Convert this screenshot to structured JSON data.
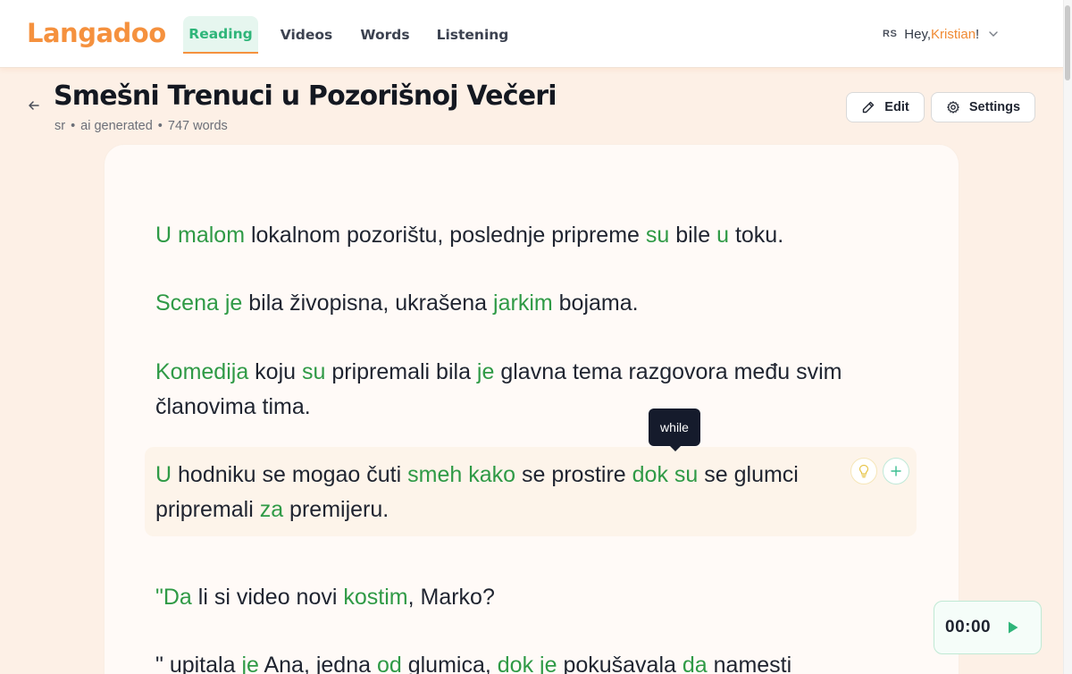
{
  "app": {
    "logo": "Langadoo"
  },
  "nav": [
    {
      "label": "Reading",
      "active": true
    },
    {
      "label": "Videos",
      "active": false
    },
    {
      "label": "Words",
      "active": false
    },
    {
      "label": "Listening",
      "active": false
    }
  ],
  "user": {
    "lang_code": "RS",
    "greeting": "Hey, ",
    "name": "Kristian",
    "suffix": "!"
  },
  "page": {
    "title": "Smešni Trenuci u Pozorišnoj Večeri",
    "meta_lang": "sr",
    "meta_source": "ai generated",
    "meta_words": "747 words"
  },
  "buttons": {
    "edit": "Edit",
    "settings": "Settings"
  },
  "tooltip": {
    "text": "while"
  },
  "player": {
    "time": "00:00"
  },
  "colors": {
    "accent_orange": "#f5913e",
    "accent_green": "#2fb57a",
    "known_word": "#2f9a46",
    "tooltip_bg": "#151b2c"
  },
  "icons": {
    "back": "arrow-left-icon",
    "edit": "pencil-icon",
    "settings": "gear-icon",
    "bulb": "lightbulb-icon",
    "plus": "plus-icon",
    "play": "play-icon",
    "chevron": "chevron-down-icon"
  },
  "paragraphs": [
    [
      {
        "t": "U",
        "k": true
      },
      {
        "t": " "
      },
      {
        "t": "malom",
        "k": true
      },
      {
        "t": " lokalnom pozorištu, poslednje pripreme "
      },
      {
        "t": "su",
        "k": true
      },
      {
        "t": " bile "
      },
      {
        "t": "u",
        "k": true
      },
      {
        "t": " toku."
      }
    ],
    [
      {
        "t": "Scena",
        "k": true
      },
      {
        "t": " "
      },
      {
        "t": "je",
        "k": true
      },
      {
        "t": " bila živopisna, ukrašena "
      },
      {
        "t": "jarkim",
        "k": true
      },
      {
        "t": " bojama."
      }
    ],
    [
      {
        "t": "Komedija",
        "k": true
      },
      {
        "t": " koju "
      },
      {
        "t": "su",
        "k": true
      },
      {
        "t": " pripremali bila "
      },
      {
        "t": "je",
        "k": true
      },
      {
        "t": " glavna tema razgovora među svim članovima tima."
      }
    ],
    [
      {
        "t": "U",
        "k": true
      },
      {
        "t": " hodniku se mogao čuti "
      },
      {
        "t": "smeh",
        "k": true
      },
      {
        "t": " "
      },
      {
        "t": "kako",
        "k": true
      },
      {
        "t": " se prostire "
      },
      {
        "t": "dok",
        "k": true
      },
      {
        "t": " "
      },
      {
        "t": "su",
        "k": true
      },
      {
        "t": " se glumci pripremali "
      },
      {
        "t": "za",
        "k": true
      },
      {
        "t": " premijeru."
      }
    ],
    [
      {
        "t": "\"Da",
        "k": true
      },
      {
        "t": " li si video novi "
      },
      {
        "t": "kostim",
        "k": true
      },
      {
        "t": ", Marko?"
      }
    ],
    [
      {
        "t": "\" upitala "
      },
      {
        "t": "je",
        "k": true
      },
      {
        "t": " Ana, jedna "
      },
      {
        "t": "od",
        "k": true
      },
      {
        "t": " glumica, "
      },
      {
        "t": "dok",
        "k": true
      },
      {
        "t": " "
      },
      {
        "t": "je",
        "k": true
      },
      {
        "t": " pokušavala "
      },
      {
        "t": "da",
        "k": true
      },
      {
        "t": " namesti"
      }
    ]
  ]
}
